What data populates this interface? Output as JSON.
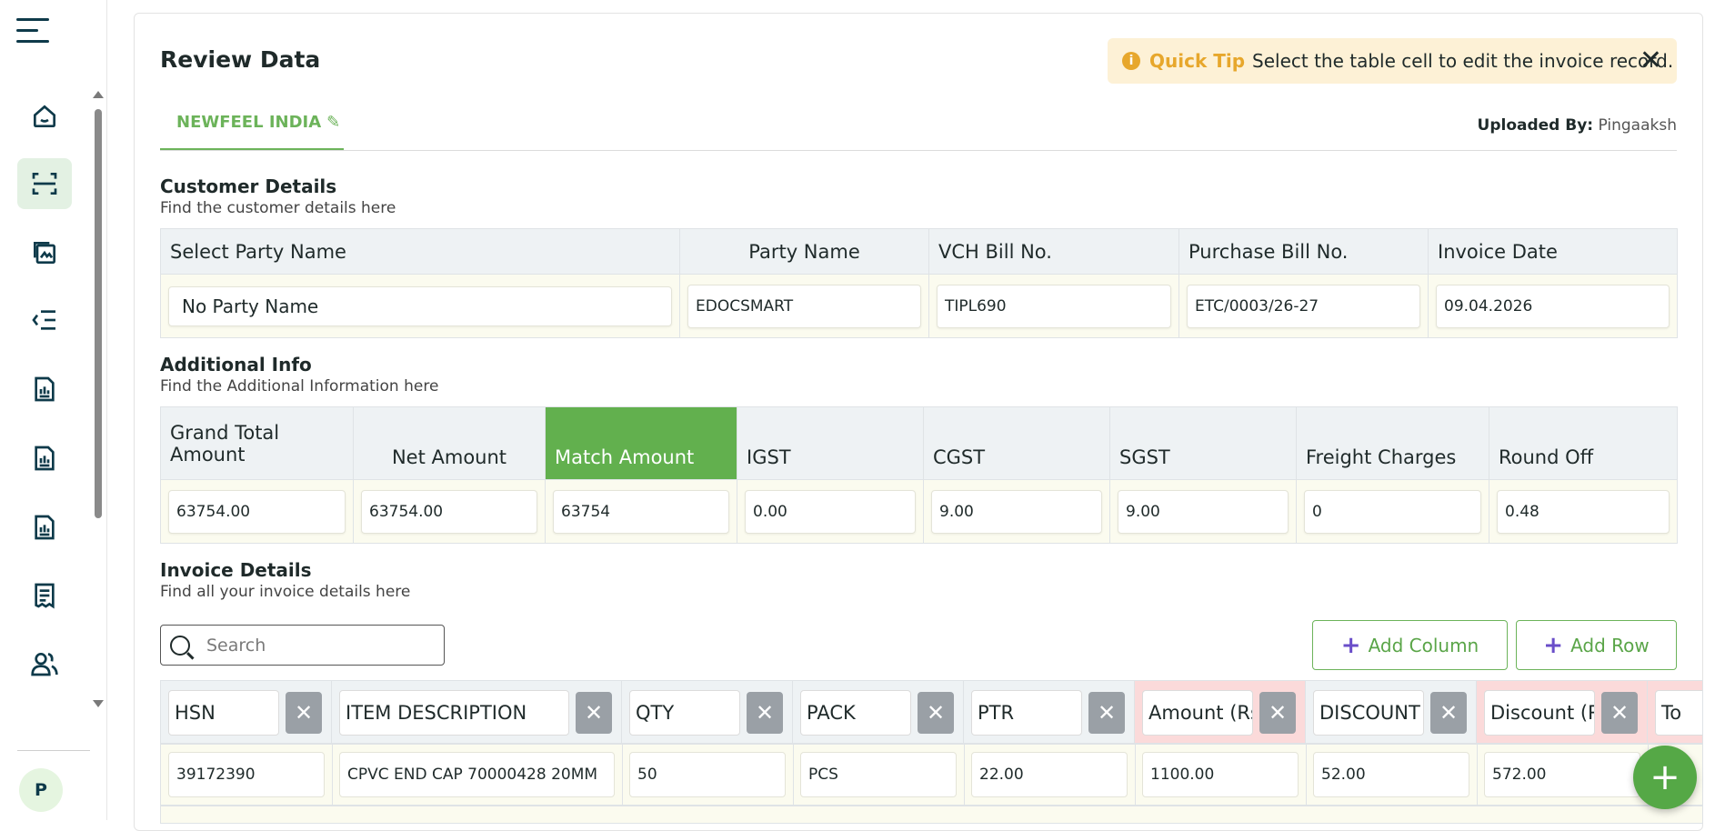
{
  "nav": {
    "icons": [
      "home-icon",
      "scan-icon",
      "documents-icon",
      "list-indent-icon",
      "report-icon",
      "report-icon",
      "report-icon",
      "receipt-icon",
      "users-icon"
    ],
    "avatar_initial": "P"
  },
  "page": {
    "title": "Review Data"
  },
  "tip": {
    "label": "Quick Tip",
    "text": "Select the table cell to edit the invoice record."
  },
  "tab": {
    "label": "NEWFEEL INDIA"
  },
  "uploaded": {
    "label": "Uploaded By:",
    "value": "Pingaaksh"
  },
  "customer": {
    "title": "Customer Details",
    "subtitle": "Find the customer details here",
    "headers": [
      "Select Party Name",
      "Party Name",
      "VCH Bill No.",
      "Purchase Bill No.",
      "Invoice Date"
    ],
    "values": [
      "No Party Name",
      "EDOCSMART",
      "TIPL690",
      "ETC/0003/26-27",
      "09.04.2026"
    ]
  },
  "additional": {
    "title": "Additional Info",
    "subtitle": "Find the Additional Information here",
    "headers": [
      "Grand Total Amount",
      "Net Amount",
      "Match Amount",
      "IGST",
      "CGST",
      "SGST",
      "Freight Charges",
      "Round Off"
    ],
    "values": [
      "63754.00",
      "63754.00",
      "63754",
      "0.00",
      "9.00",
      "9.00",
      "0",
      "0.48"
    ],
    "match_color": "#62b04e"
  },
  "invoice": {
    "title": "Invoice Details",
    "subtitle": "Find all your invoice details here",
    "search_placeholder": "Search",
    "add_column_label": "Add Column",
    "add_row_label": "Add Row",
    "columns": [
      "HSN",
      "ITEM DESCRIPTION",
      "QTY",
      "PACK",
      "PTR",
      "Amount (Rs",
      "DISCOUNT",
      "Discount (R",
      "To"
    ],
    "row1": [
      "39172390",
      "CPVC END CAP 70000428 20MM",
      "50",
      "PCS",
      "22.00",
      "1100.00",
      "52.00",
      "572.00"
    ]
  },
  "colors": {
    "accent": "#6cb35a",
    "brand_dark": "#0e3a4a",
    "tip_bg": "#fdf1d6",
    "tip_accent": "#e7a72c",
    "pink_column": "#fbdada"
  }
}
